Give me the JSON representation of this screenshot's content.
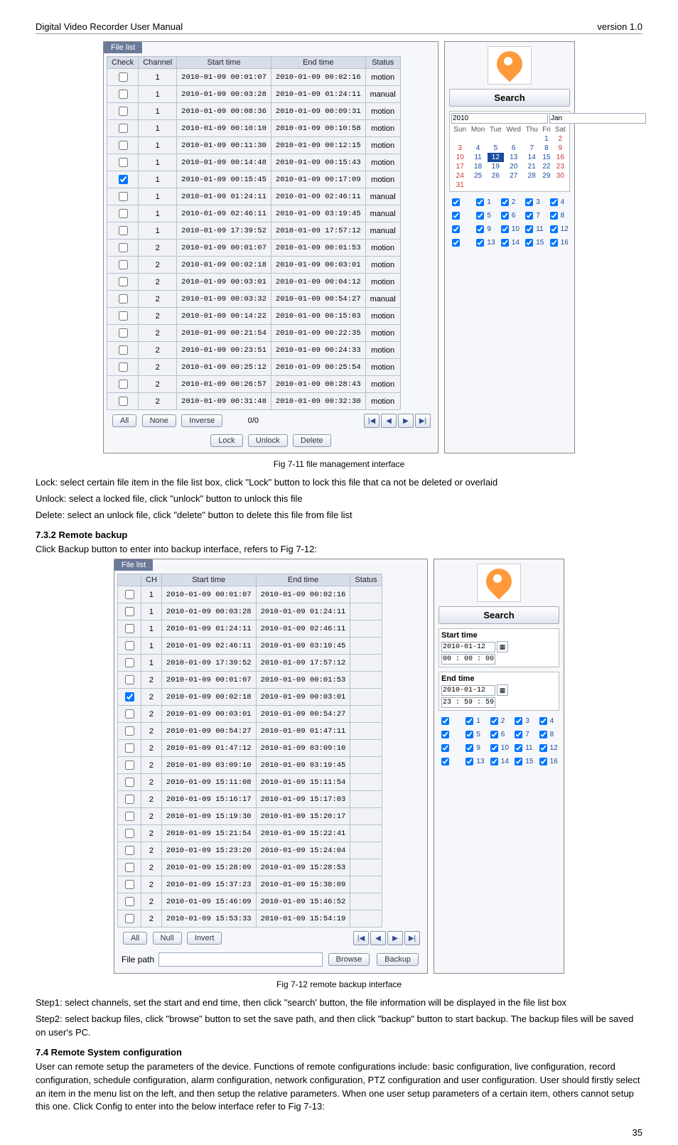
{
  "header": {
    "left": "Digital Video Recorder User Manual",
    "right": "version 1.0"
  },
  "fig1": {
    "tab": "File list",
    "columns": [
      "Check",
      "Channel",
      "Start time",
      "End time",
      "Status"
    ],
    "rows": [
      {
        "ch": "1",
        "start": "2010-01-09 00:01:07",
        "end": "2010-01-09 00:02:16",
        "status": "motion",
        "checked": false
      },
      {
        "ch": "1",
        "start": "2010-01-09 00:03:28",
        "end": "2010-01-09 01:24:11",
        "status": "manual",
        "checked": false
      },
      {
        "ch": "1",
        "start": "2010-01-09 00:08:36",
        "end": "2010-01-09 00:09:31",
        "status": "motion",
        "checked": false
      },
      {
        "ch": "1",
        "start": "2010-01-09 00:10:10",
        "end": "2010-01-09 00:10:58",
        "status": "motion",
        "checked": false
      },
      {
        "ch": "1",
        "start": "2010-01-09 00:11:30",
        "end": "2010-01-09 00:12:15",
        "status": "motion",
        "checked": false
      },
      {
        "ch": "1",
        "start": "2010-01-09 00:14:48",
        "end": "2010-01-09 00:15:43",
        "status": "motion",
        "checked": false
      },
      {
        "ch": "1",
        "start": "2010-01-09 00:15:45",
        "end": "2010-01-09 00:17:09",
        "status": "motion",
        "checked": true
      },
      {
        "ch": "1",
        "start": "2010-01-09 01:24:11",
        "end": "2010-01-09 02:46:11",
        "status": "manual",
        "checked": false
      },
      {
        "ch": "1",
        "start": "2010-01-09 02:46:11",
        "end": "2010-01-09 03:19:45",
        "status": "manual",
        "checked": false
      },
      {
        "ch": "1",
        "start": "2010-01-09 17:39:52",
        "end": "2010-01-09 17:57:12",
        "status": "manual",
        "checked": false
      },
      {
        "ch": "2",
        "start": "2010-01-09 00:01:07",
        "end": "2010-01-09 00:01:53",
        "status": "motion",
        "checked": false
      },
      {
        "ch": "2",
        "start": "2010-01-09 00:02:18",
        "end": "2010-01-09 00:03:01",
        "status": "motion",
        "checked": false
      },
      {
        "ch": "2",
        "start": "2010-01-09 00:03:01",
        "end": "2010-01-09 00:04:12",
        "status": "motion",
        "checked": false
      },
      {
        "ch": "2",
        "start": "2010-01-09 00:03:32",
        "end": "2010-01-09 00:54:27",
        "status": "manual",
        "checked": false
      },
      {
        "ch": "2",
        "start": "2010-01-09 00:14:22",
        "end": "2010-01-09 00:15:03",
        "status": "motion",
        "checked": false
      },
      {
        "ch": "2",
        "start": "2010-01-09 00:21:54",
        "end": "2010-01-09 00:22:35",
        "status": "motion",
        "checked": false
      },
      {
        "ch": "2",
        "start": "2010-01-09 00:23:51",
        "end": "2010-01-09 00:24:33",
        "status": "motion",
        "checked": false
      },
      {
        "ch": "2",
        "start": "2010-01-09 00:25:12",
        "end": "2010-01-09 00:25:54",
        "status": "motion",
        "checked": false
      },
      {
        "ch": "2",
        "start": "2010-01-09 00:26:57",
        "end": "2010-01-09 00:28:43",
        "status": "motion",
        "checked": false
      },
      {
        "ch": "2",
        "start": "2010-01-09 00:31:48",
        "end": "2010-01-09 00:32:30",
        "status": "motion",
        "checked": false
      }
    ],
    "buttons": {
      "all": "All",
      "none": "None",
      "inverse": "Inverse",
      "page": "0/0",
      "lock": "Lock",
      "unlock": "Unlock",
      "delete": "Delete"
    },
    "side": {
      "search": "Search",
      "year": "2010",
      "month": "Jan",
      "dow": [
        "Sun",
        "Mon",
        "Tue",
        "Wed",
        "Thu",
        "Fri",
        "Sat"
      ],
      "weeks": [
        [
          "",
          "",
          "",
          "",
          "",
          "1",
          "2"
        ],
        [
          "3",
          "4",
          "5",
          "6",
          "7",
          "8",
          "9"
        ],
        [
          "10",
          "11",
          "12",
          "13",
          "14",
          "15",
          "16"
        ],
        [
          "17",
          "18",
          "19",
          "20",
          "21",
          "22",
          "23"
        ],
        [
          "24",
          "25",
          "26",
          "27",
          "28",
          "29",
          "30"
        ],
        [
          "31",
          "",
          "",
          "",
          "",
          "",
          ""
        ]
      ],
      "selected_day": "12",
      "channels": [
        "1",
        "2",
        "3",
        "4",
        "5",
        "6",
        "7",
        "8",
        "9",
        "10",
        "11",
        "12",
        "13",
        "14",
        "15",
        "16"
      ]
    },
    "caption": "Fig 7-11 file management interface"
  },
  "para1": [
    "Lock: select certain file item in the file list box, click \"Lock\" button to lock this file that ca not be deleted or overlaid",
    "Unlock: select a locked file, click \"unlock\" button to unlock this file",
    "Delete: select an unlock file, click \"delete\" button to delete this file from file list"
  ],
  "heading1": "7.3.2  Remote backup",
  "para2": "Click Backup button to enter into backup interface, refers to Fig 7-12:",
  "fig2": {
    "tab": "File list",
    "columns": [
      "",
      "CH",
      "Start time",
      "End time",
      "Status"
    ],
    "rows": [
      {
        "ch": "1",
        "start": "2010-01-09 00:01:07",
        "end": "2010-01-09 00:02:16",
        "checked": false
      },
      {
        "ch": "1",
        "start": "2010-01-09 00:03:28",
        "end": "2010-01-09 01:24:11",
        "checked": false
      },
      {
        "ch": "1",
        "start": "2010-01-09 01:24:11",
        "end": "2010-01-09 02:46:11",
        "checked": false
      },
      {
        "ch": "1",
        "start": "2010-01-09 02:46:11",
        "end": "2010-01-09 03:19:45",
        "checked": false
      },
      {
        "ch": "1",
        "start": "2010-01-09 17:39:52",
        "end": "2010-01-09 17:57:12",
        "checked": false
      },
      {
        "ch": "2",
        "start": "2010-01-09 00:01:07",
        "end": "2010-01-09 00:01:53",
        "checked": false
      },
      {
        "ch": "2",
        "start": "2010-01-09 00:02:18",
        "end": "2010-01-09 00:03:01",
        "checked": true
      },
      {
        "ch": "2",
        "start": "2010-01-09 00:03:01",
        "end": "2010-01-09 00:54:27",
        "checked": false
      },
      {
        "ch": "2",
        "start": "2010-01-09 00:54:27",
        "end": "2010-01-09 01:47:11",
        "checked": false
      },
      {
        "ch": "2",
        "start": "2010-01-09 01:47:12",
        "end": "2010-01-09 03:09:10",
        "checked": false
      },
      {
        "ch": "2",
        "start": "2010-01-09 03:09:10",
        "end": "2010-01-09 03:19:45",
        "checked": false
      },
      {
        "ch": "2",
        "start": "2010-01-09 15:11:08",
        "end": "2010-01-09 15:11:54",
        "checked": false
      },
      {
        "ch": "2",
        "start": "2010-01-09 15:16:17",
        "end": "2010-01-09 15:17:03",
        "checked": false
      },
      {
        "ch": "2",
        "start": "2010-01-09 15:19:30",
        "end": "2010-01-09 15:20:17",
        "checked": false
      },
      {
        "ch": "2",
        "start": "2010-01-09 15:21:54",
        "end": "2010-01-09 15:22:41",
        "checked": false
      },
      {
        "ch": "2",
        "start": "2010-01-09 15:23:20",
        "end": "2010-01-09 15:24:04",
        "checked": false
      },
      {
        "ch": "2",
        "start": "2010-01-09 15:28:09",
        "end": "2010-01-09 15:28:53",
        "checked": false
      },
      {
        "ch": "2",
        "start": "2010-01-09 15:37:23",
        "end": "2010-01-09 15:38:09",
        "checked": false
      },
      {
        "ch": "2",
        "start": "2010-01-09 15:46:09",
        "end": "2010-01-09 15:46:52",
        "checked": false
      },
      {
        "ch": "2",
        "start": "2010-01-09 15:53:33",
        "end": "2010-01-09 15:54:19",
        "checked": false
      }
    ],
    "buttons": {
      "all": "All",
      "null": "Null",
      "invert": "Invert",
      "browse": "Browse",
      "backup": "Backup",
      "filepath": "File path"
    },
    "side": {
      "search": "Search",
      "start_label": "Start time",
      "start_date": "2010-01-12",
      "start_time": "00 : 00 : 00",
      "end_label": "End time",
      "end_date": "2010-01-12",
      "end_time": "23 : 59 : 59",
      "channels": [
        "1",
        "2",
        "3",
        "4",
        "5",
        "6",
        "7",
        "8",
        "9",
        "10",
        "11",
        "12",
        "13",
        "14",
        "15",
        "16"
      ]
    },
    "caption": "Fig 7-12 remote backup interface"
  },
  "para3": [
    "Step1: select channels, set the start and end time, then click \"search' button, the file information will be displayed in the file list box",
    "Step2: select backup files, click \"browse\" button to set the save path, and then click \"backup\" button to start backup. The backup files will be saved on user's PC."
  ],
  "heading2": "7.4  Remote System configuration",
  "para4": "User can remote setup the parameters of the device. Functions of remote configurations include: basic configuration, live configuration, record configuration, schedule configuration, alarm configuration, network configuration, PTZ configuration and user configuration. User should firstly select an item in the menu list on the left, and then setup the relative parameters. When one user setup parameters of a certain item, others cannot setup this one. Click Config to enter into the below interface refer to Fig 7-13:",
  "page_number": "35"
}
